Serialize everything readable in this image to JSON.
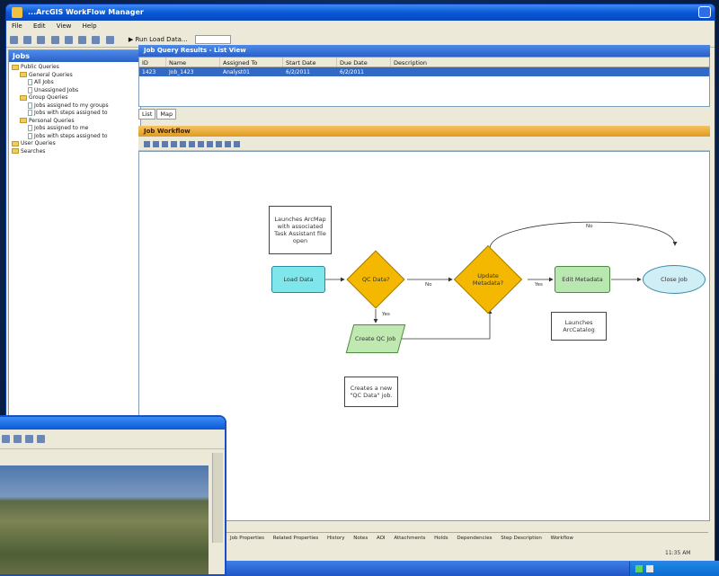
{
  "window": {
    "title": "...ArcGIS WorkFlow Manager"
  },
  "menu": [
    "File",
    "Edit",
    "View",
    "Help"
  ],
  "toolbar": {
    "run_label": "Run Load Data..."
  },
  "jobs": {
    "title": "Jobs",
    "tree": [
      {
        "label": "Public Queries",
        "level": 0,
        "kind": "folder"
      },
      {
        "label": "General Queries",
        "level": 1,
        "kind": "folder"
      },
      {
        "label": "All Jobs",
        "level": 2,
        "kind": "doc"
      },
      {
        "label": "Unassigned Jobs",
        "level": 2,
        "kind": "doc"
      },
      {
        "label": "Group Queries",
        "level": 1,
        "kind": "folder"
      },
      {
        "label": "Jobs assigned to my groups",
        "level": 2,
        "kind": "doc"
      },
      {
        "label": "Jobs with steps assigned to",
        "level": 2,
        "kind": "doc"
      },
      {
        "label": "Personal Queries",
        "level": 1,
        "kind": "folder"
      },
      {
        "label": "Jobs assigned to me",
        "level": 2,
        "kind": "doc"
      },
      {
        "label": "Jobs with steps assigned to",
        "level": 2,
        "kind": "doc"
      },
      {
        "label": "User Queries",
        "level": 0,
        "kind": "folder"
      },
      {
        "label": "Searches",
        "level": 0,
        "kind": "folder"
      }
    ]
  },
  "listview": {
    "title": "Job Query Results - List View",
    "columns": [
      "ID",
      "Name",
      "Assigned To",
      "Start Date",
      "Due Date",
      "Description"
    ],
    "row": [
      "1423",
      "Job_1423",
      "Analyst01",
      "6/2/2011",
      "6/2/2011",
      ""
    ],
    "tabs": [
      "List",
      "Map"
    ]
  },
  "workflow": {
    "title": "Job Workflow",
    "nodes": {
      "note1": "Launches ArcMap with associated Task Assistant file open",
      "load": "Load Data",
      "qc": "QC Data?",
      "update": "Update Metadata?",
      "edit": "Edit Metadata",
      "close": "Close Job",
      "create": "Create QC Job",
      "note2": "Launches ArcCatalog",
      "note3": "Creates a new \"QC Data\" job."
    },
    "edges": {
      "no1": "No",
      "no2": "No",
      "yes1": "Yes",
      "yes2": "Yes"
    }
  },
  "bottom_tabs": [
    "Job Properties",
    "Related Properties",
    "History",
    "Notes",
    "AOI",
    "Attachments",
    "Holds",
    "Dependencies",
    "Step Description",
    "Workflow"
  ],
  "tray": {
    "time": "11:35 AM"
  }
}
